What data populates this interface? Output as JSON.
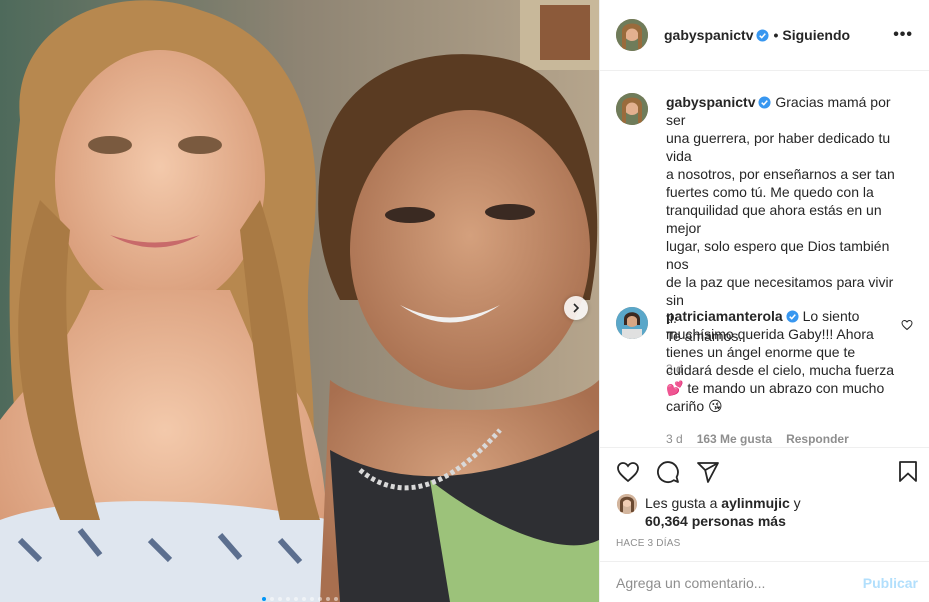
{
  "post": {
    "username": "gabyspanictv",
    "follow_status": "Siguiendo",
    "more": "•••",
    "caption": {
      "username": "gabyspanictv",
      "lines": [
        "Gracias mamá por ser",
        "una guerrera, por haber dedicado tu vida",
        "a nosotros, por enseñarnos a ser tan",
        "fuertes como tú. Me quedo con la",
        "tranquilidad que ahora estás en un mejor",
        "lugar, solo espero que Dios también nos",
        "de la paz que necesitamos para vivir sin",
        "ti.",
        "Te amamos."
      ],
      "time": "3 d"
    },
    "comment": {
      "username": "patriciamanterola",
      "lines": [
        "Lo siento",
        "muchísimo querida Gaby!!! Ahora",
        "tienes un ángel enorme que te",
        "cuidará desde el cielo, mucha fuerza",
        "💕 te mando un abrazo con mucho",
        "cariño 😘"
      ],
      "time": "3 d",
      "likes": "163 Me gusta",
      "reply": "Responder"
    },
    "likes": {
      "prefix": "Les gusta a",
      "user": "aylinmujic",
      "and": "y",
      "count_text": "60,364 personas más"
    },
    "timestamp": "HACE 3 DÍAS",
    "add_comment_placeholder": "Agrega un comentario...",
    "publish_label": "Publicar",
    "carousel": {
      "count": 10,
      "active_index": 0
    }
  },
  "icons": [
    "verified-badge-icon",
    "heart-icon",
    "comment-icon",
    "share-icon",
    "bookmark-icon",
    "chevron-right-icon",
    "more-options-icon"
  ],
  "colors": {
    "accent": "#0095f6",
    "verified": "#3897f0",
    "publish_disabled": "#b2dffc",
    "muted": "#8e8e8e",
    "like_heart": "#262626"
  }
}
